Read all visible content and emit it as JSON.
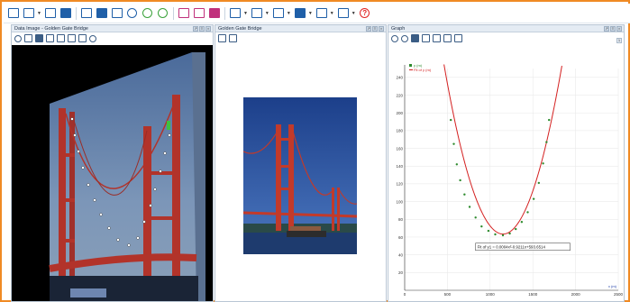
{
  "toolbar": {
    "buttons": [
      {
        "name": "new-experiment-icon"
      },
      {
        "name": "open-file-icon"
      },
      {
        "name": "save-icon"
      },
      {
        "name": "record-icon"
      },
      {
        "name": "print-icon"
      },
      {
        "name": "data-table-icon"
      },
      {
        "name": "page-icon"
      },
      {
        "name": "timer-icon"
      },
      {
        "name": "play-icon"
      },
      {
        "name": "refresh-icon"
      },
      {
        "name": "graph-tool-icon"
      },
      {
        "name": "screen-tool-icon"
      },
      {
        "name": "pdf-icon"
      },
      {
        "name": "analysis-icon"
      },
      {
        "name": "checkbox-icon"
      },
      {
        "name": "display-icon"
      },
      {
        "name": "window-icon"
      },
      {
        "name": "chart-icon"
      },
      {
        "name": "list-icon"
      },
      {
        "name": "help-icon"
      }
    ],
    "help_symbol": "?"
  },
  "panels": {
    "video": {
      "title": "Data Image - Golden Gate Bridge"
    },
    "photo": {
      "title": "Golden Gate Bridge"
    },
    "graph": {
      "title": "Graph",
      "page_number": "1"
    }
  },
  "chart_data": {
    "type": "scatter",
    "title": "",
    "xlabel": "x (m)",
    "ylabel": "",
    "xlim": [
      0,
      2500
    ],
    "ylim": [
      0,
      250
    ],
    "x_ticks": [
      0,
      500,
      1000,
      1500,
      2000,
      2500
    ],
    "y_ticks": [
      20,
      40,
      60,
      80,
      100,
      120,
      140,
      160,
      180,
      200,
      220,
      240
    ],
    "legend": [
      "y (m)",
      "Fit of y (m)"
    ],
    "legend_position": "top-left",
    "annotation": "Fit of y1 = 0.0004x²-0.9211x+593.6514",
    "series": [
      {
        "name": "y (m)",
        "color": "#2e8b2e",
        "points": [
          [
            540,
            192
          ],
          [
            575,
            165
          ],
          [
            610,
            142
          ],
          [
            650,
            124
          ],
          [
            700,
            108
          ],
          [
            760,
            94
          ],
          [
            830,
            82
          ],
          [
            900,
            72
          ],
          [
            980,
            67
          ],
          [
            1060,
            63
          ],
          [
            1150,
            62
          ],
          [
            1230,
            64
          ],
          [
            1300,
            69
          ],
          [
            1370,
            77
          ],
          [
            1440,
            88
          ],
          [
            1510,
            103
          ],
          [
            1570,
            121
          ],
          [
            1620,
            143
          ],
          [
            1660,
            167
          ],
          [
            1690,
            192
          ]
        ]
      },
      {
        "name": "Fit of y (m)",
        "color": "#d42020",
        "fit": {
          "a": 0.0004,
          "b": -0.9211,
          "c": 593.6514
        }
      }
    ]
  }
}
